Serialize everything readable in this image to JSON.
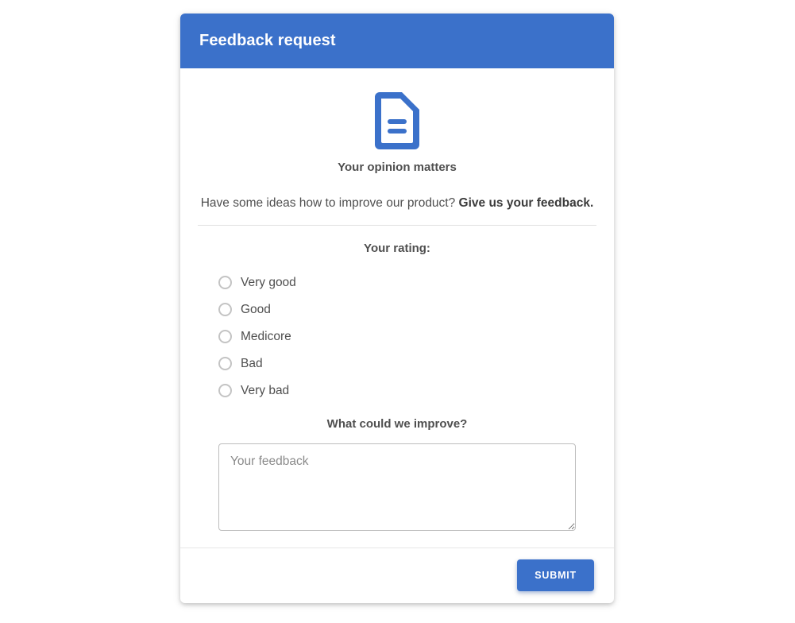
{
  "card": {
    "header": {
      "title": "Feedback request"
    },
    "icon": {
      "name": "document-icon",
      "color": "#3b71ca"
    },
    "body": {
      "opinion_title": "Your opinion matters",
      "lead_text": "Have some ideas how to improve our product?",
      "lead_emphasis": "Give us your feedback.",
      "rating_title": "Your rating:",
      "rating_options": [
        {
          "label": "Very good",
          "selected": false
        },
        {
          "label": "Good",
          "selected": false
        },
        {
          "label": "Medicore",
          "selected": false
        },
        {
          "label": "Bad",
          "selected": false
        },
        {
          "label": "Very bad",
          "selected": false
        }
      ],
      "improve_title": "What could we improve?",
      "feedback": {
        "placeholder": "Your feedback",
        "value": ""
      }
    },
    "footer": {
      "submit_label": "SUBMIT"
    }
  },
  "colors": {
    "primary": "#3b71ca",
    "text": "#4f4f4f",
    "border": "#e0e0e0",
    "page_background": "#ffffff"
  }
}
